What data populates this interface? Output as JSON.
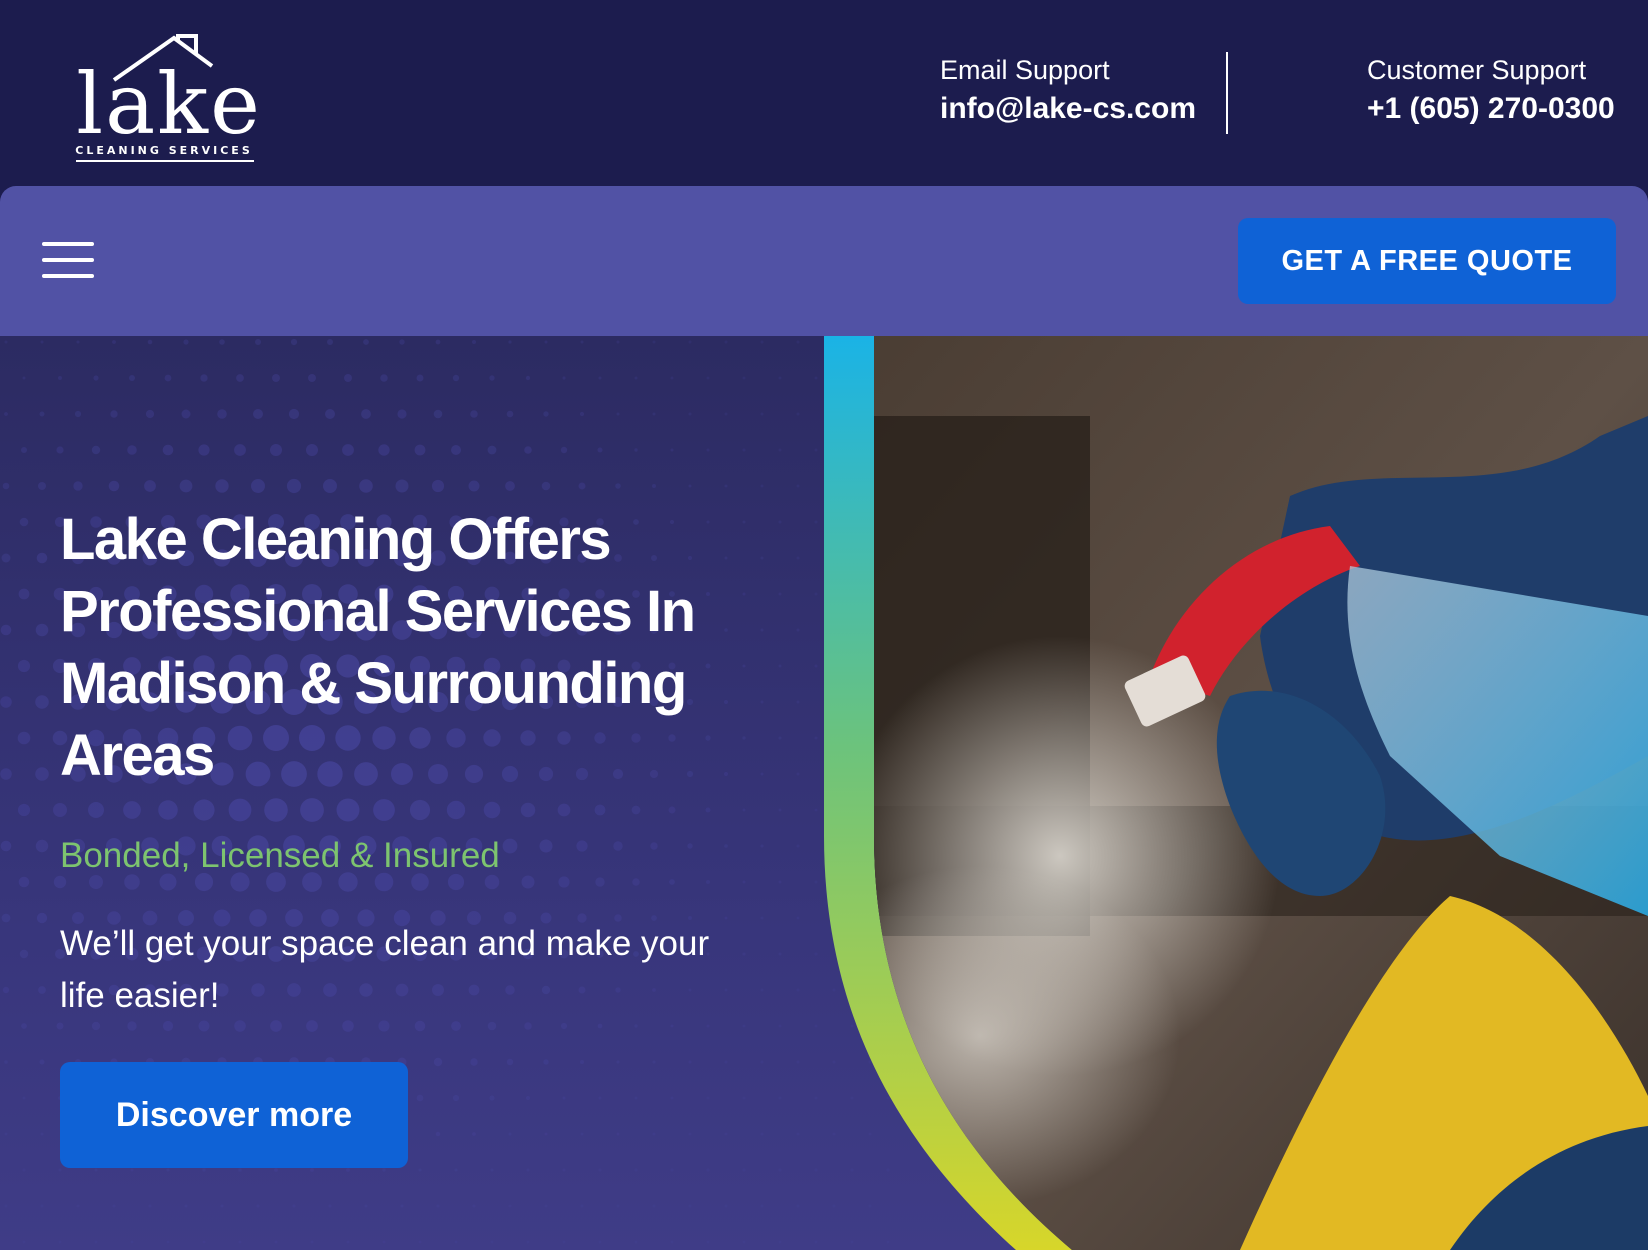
{
  "brand": {
    "logo_word": "lake",
    "logo_tagline": "CLEANING SERVICES"
  },
  "header": {
    "email_label": "Email Support",
    "email_value": "info@lake-cs.com",
    "phone_label": "Customer Support",
    "phone_value": "+1 (605) 270-0300"
  },
  "nav": {
    "menu_icon": "hamburger-menu-icon",
    "quote_button": "GET A FREE QUOTE"
  },
  "hero": {
    "title": "Lake Cleaning Offers Professional Services In Madison & Surrounding Areas",
    "tagline": "Bonded, Licensed & Insured",
    "description": "We’ll get your space clean and make your life easier!",
    "cta": "Discover more"
  },
  "colors": {
    "header_bg": "#1c1c4e",
    "nav_bg": "#5152a5",
    "hero_bg": "#2c2b62",
    "button": "#0f62d6",
    "tagline": "#7dc46f",
    "accent_gradient": [
      "#1ab3e6",
      "#6cc37c",
      "#d7d62a"
    ]
  }
}
